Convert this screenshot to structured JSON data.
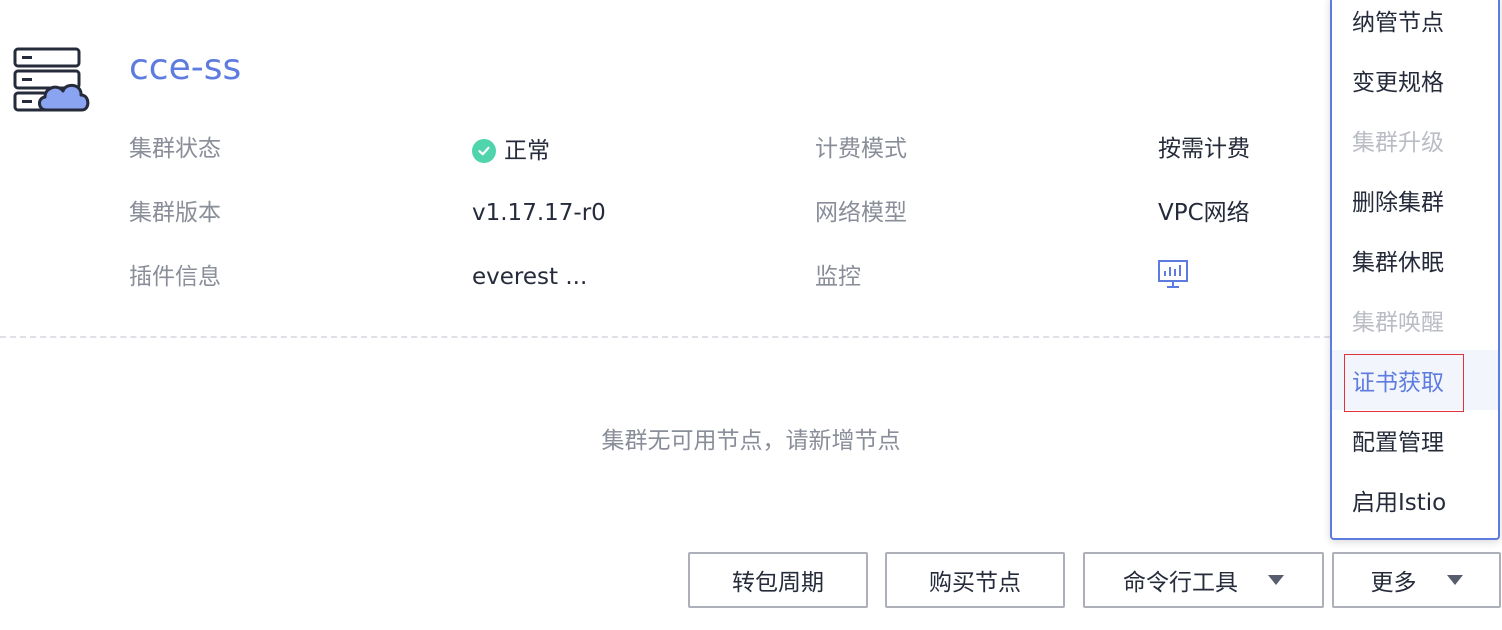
{
  "cluster": {
    "name": "cce-ss"
  },
  "info": {
    "status_label": "集群状态",
    "status_value": "正常",
    "billing_label": "计费模式",
    "billing_value": "按需计费",
    "version_label": "集群版本",
    "version_value": "v1.17.17-r0",
    "network_label": "网络模型",
    "network_value": "VPC网络",
    "addon_label": "插件信息",
    "addon_value": "everest ...",
    "monitor_label": "监控"
  },
  "empty_hint": "集群无可用节点，请新增节点",
  "buttons": {
    "renew": "转包周期",
    "buy_node": "购买节点",
    "cli_tools": "命令行工具",
    "more": "更多"
  },
  "menu": {
    "items": [
      {
        "label": "纳管节点",
        "state": "normal"
      },
      {
        "label": "变更规格",
        "state": "normal"
      },
      {
        "label": "集群升级",
        "state": "disabled"
      },
      {
        "label": "删除集群",
        "state": "normal"
      },
      {
        "label": "集群休眠",
        "state": "normal"
      },
      {
        "label": "集群唤醒",
        "state": "disabled"
      },
      {
        "label": "证书获取",
        "state": "active"
      },
      {
        "label": "配置管理",
        "state": "normal"
      },
      {
        "label": "启用Istio",
        "state": "normal"
      }
    ]
  },
  "icons": {
    "cluster": "cloud-server-icon",
    "status": "check-circle-icon",
    "monitor": "monitor-chart-icon",
    "caret": "caret-down-icon"
  },
  "colors": {
    "accent": "#5e7ce0",
    "success": "#50d4ab",
    "muted": "#8a8e99",
    "disabled": "#babdc5",
    "highlight": "#e0323c"
  }
}
